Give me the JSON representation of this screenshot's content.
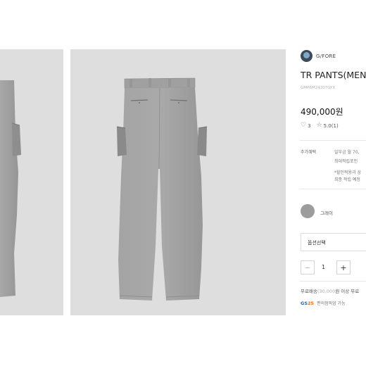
{
  "product": {
    "brand": "G/FORE",
    "title": "TR PANTS(MEN)",
    "code": "GMP6M24307GYX",
    "price": "490,000원",
    "likes": "3",
    "rating": "5.0(1)"
  },
  "benefits": {
    "label": "추가혜택",
    "lines": [
      "일부금 월 70,",
      "최대적립포인",
      "*할인적용과 상",
      "최종 적립 예정"
    ]
  },
  "color": {
    "name": "그레이",
    "swatch": "#9c9c9c"
  },
  "option": {
    "placeholder": "옵션선택"
  },
  "quantity": {
    "minus": "−",
    "value": "1",
    "plus": "+"
  },
  "shipping": {
    "prefix": "무료배송",
    "threshold": "(30,000",
    "suffix": "원 이상 무료"
  },
  "gs25": {
    "logo_text": "GS",
    "logo_num": "25",
    "text": "편의점픽업 가능"
  },
  "colors": {
    "image_bg": "#dedede",
    "pants": "#9d9d9d",
    "pants_shadow": "#8a8a8a",
    "gs_blue": "#2a62b0",
    "gs_orange": "#e5732a"
  }
}
